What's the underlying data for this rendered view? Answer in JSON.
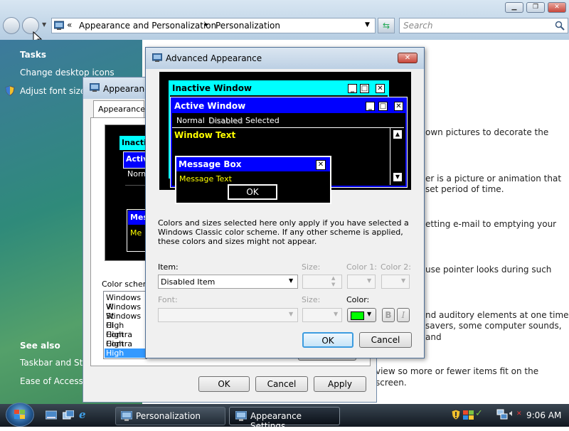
{
  "explorer": {
    "breadcrumb": [
      "Appearance and Personalization",
      "Personalization"
    ],
    "breadcrumb_prefix": "«",
    "breadcrumb_sep": "▸",
    "search_placeholder": "Search"
  },
  "tasks": {
    "heading": "Tasks",
    "items": [
      "Change desktop icons",
      "Adjust font size ("
    ]
  },
  "see_also": {
    "heading": "See also",
    "items": [
      "Taskbar and Star",
      "Ease of Access"
    ]
  },
  "main_texts": [
    "own pictures to decorate the",
    "er is a picture or animation that",
    "set period of time.",
    "etting e-mail to emptying your",
    "use pointer looks during such",
    "nd auditory elements at one time",
    "savers, some computer sounds, and",
    "view so more or fewer items fit on the screen."
  ],
  "appearance_settings": {
    "title": "Appearance",
    "tab": "Appearance",
    "preview_inactive": "Inactiv",
    "preview_active": "Activ",
    "preview_normal": "Norm",
    "preview_message": "Mes",
    "preview_msgtext": "Me",
    "color_scheme_label": "Color scheme",
    "schemes": [
      "Windows Vi",
      "Windows St",
      "Windows Cl",
      "High Contra",
      "High Contra",
      "High Contra",
      "High Contra"
    ],
    "ok": "OK",
    "cancel": "Cancel",
    "apply": "Apply"
  },
  "advanced": {
    "title": "Advanced Appearance",
    "preview": {
      "inactive_window": "Inactive Window",
      "active_window": "Active Window",
      "menu_normal": "Normal",
      "menu_disabled": "Disabled",
      "menu_selected": "Selected",
      "window_text": "Window Text",
      "message_box": "Message Box",
      "message_text": "Message Text",
      "ok": "OK",
      "close_glyph": "✕"
    },
    "info": "Colors and sizes selected here only apply if you have selected a Windows Classic color scheme. If any other scheme is applied, these colors and sizes might not appear.",
    "item_label": "Item:",
    "item_value": "Disabled Item",
    "size_label": "Size:",
    "color1_label": "Color 1:",
    "color2_label": "Color 2:",
    "font_label": "Font:",
    "font_size_label": "Size:",
    "color_label": "Color:",
    "color_value": "#00ff00",
    "bold": "B",
    "italic": "I",
    "ok": "OK",
    "cancel": "Cancel"
  },
  "taskbar": {
    "items": [
      "Personalization",
      "Appearance Settings"
    ],
    "clock": "9:06 AM"
  },
  "colors": {
    "classic_active": "#0000ff",
    "classic_inactive": "#00ffff",
    "classic_window_text": "#ffff00",
    "classic_window_bg": "#000000"
  }
}
